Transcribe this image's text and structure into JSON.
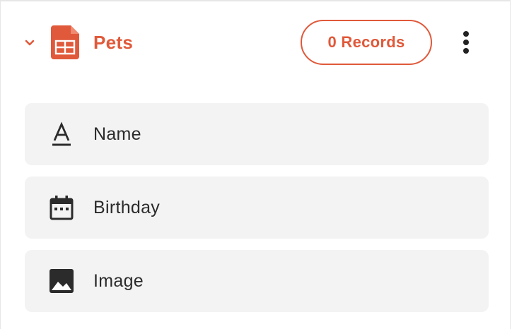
{
  "table": {
    "name": "Pets",
    "records_label": "0 Records",
    "accent_color": "#e0593a",
    "icon": "table-icon",
    "expanded": true
  },
  "fields": [
    {
      "label": "Name",
      "icon": "text-field-icon"
    },
    {
      "label": "Birthday",
      "icon": "calendar-icon"
    },
    {
      "label": "Image",
      "icon": "image-icon"
    }
  ]
}
